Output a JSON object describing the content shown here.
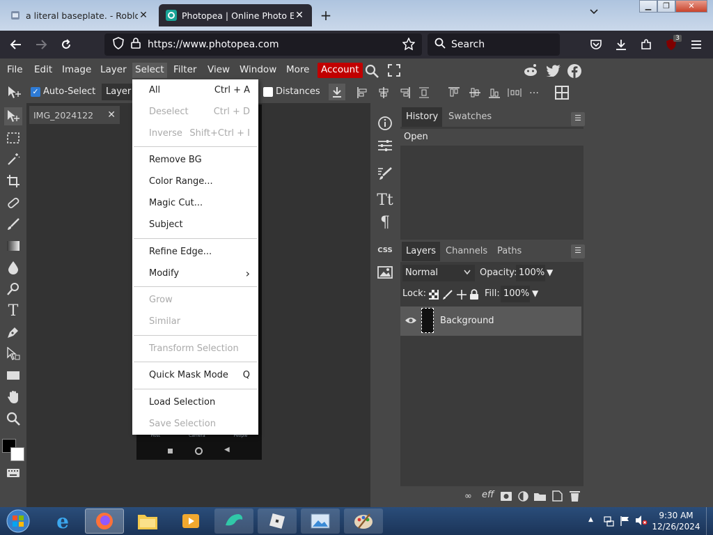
{
  "browser": {
    "tabs": [
      {
        "title": "a literal baseplate. - Roblox",
        "active": false
      },
      {
        "title": "Photopea | Online Photo Editor",
        "active": true
      }
    ],
    "url": "https://www.photopea.com",
    "search_placeholder": "Search",
    "extension_badge": "3"
  },
  "menu": {
    "items": [
      "File",
      "Edit",
      "Image",
      "Layer",
      "Select",
      "Filter",
      "View",
      "Window",
      "More"
    ],
    "account": "Account"
  },
  "options": {
    "auto_select": "Auto-Select",
    "layer_select": "Layer",
    "distances": "Distances"
  },
  "document": {
    "tab_title": "IMG_2024122"
  },
  "dropdown": {
    "items": [
      {
        "label": "All",
        "shortcut": "Ctrl + A",
        "disabled": false
      },
      {
        "label": "Deselect",
        "shortcut": "Ctrl + D",
        "disabled": true
      },
      {
        "label": "Inverse",
        "shortcut": "Shift+Ctrl + I",
        "disabled": true
      },
      {
        "label": "Remove BG",
        "shortcut": "",
        "disabled": false
      },
      {
        "label": "Color Range...",
        "shortcut": "",
        "disabled": false
      },
      {
        "label": "Magic Cut...",
        "shortcut": "",
        "disabled": false
      },
      {
        "label": "Subject",
        "shortcut": "",
        "disabled": false
      },
      {
        "label": "Refine Edge...",
        "shortcut": "",
        "disabled": false
      },
      {
        "label": "Modify",
        "shortcut": "›",
        "disabled": false
      },
      {
        "label": "Grow",
        "shortcut": "",
        "disabled": true
      },
      {
        "label": "Similar",
        "shortcut": "",
        "disabled": true
      },
      {
        "label": "Transform Selection",
        "shortcut": "",
        "disabled": true
      },
      {
        "label": "Quick Mask Mode",
        "shortcut": "Q",
        "disabled": false
      },
      {
        "label": "Load Selection",
        "shortcut": "",
        "disabled": false
      },
      {
        "label": "Save Selection",
        "shortcut": "",
        "disabled": true
      }
    ]
  },
  "history_panel": {
    "tabs": [
      "History",
      "Swatches"
    ],
    "entries": [
      "Open"
    ]
  },
  "layers_panel": {
    "tabs": [
      "Layers",
      "Channels",
      "Paths"
    ],
    "blend_mode": "Normal",
    "opacity_label": "Opacity:",
    "opacity": "100%",
    "lock_label": "Lock:",
    "fill_label": "Fill:",
    "fill": "100%",
    "layers": [
      {
        "name": "Background"
      }
    ]
  },
  "sidepanel": {
    "css_label": "CSS"
  },
  "phone_nav": [
    "Host",
    "Camera",
    "People"
  ],
  "taskbar": {
    "time": "9:30 AM",
    "date": "12/26/2024"
  },
  "colors": {
    "accent_red": "#c10000",
    "browser_dark": "#2b2a33",
    "panel": "#474747"
  }
}
